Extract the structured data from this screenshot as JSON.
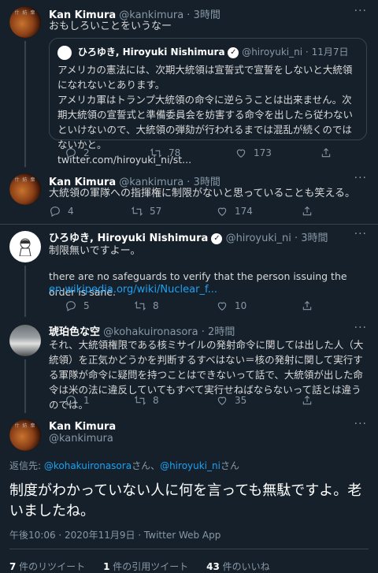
{
  "tweets": [
    {
      "name": "Kan Kimura",
      "handle": "@kankimura",
      "time": "3時間",
      "text": "おもしろいことをいうなー",
      "quote": {
        "name": "ひろゆき, Hiroyuki Nishimura",
        "handle": "@hiroyuki_ni",
        "date": "11月7日",
        "text": "アメリカの憲法には、次期大統領は宣誓式で宣誓をしないと大統領になれないとあります。\nアメリカ軍はトランプ大統領の命令に逆らうことは出来ません。次期大統領の宣誓式と準備委員会を妨害する命令を出したら従わないといけないので、大統領の弾劾が行われるまでは混乱が続くのではないかと。",
        "link": "twitter.com/hiroyuki_ni/st..."
      },
      "replies": "2",
      "retweets": "78",
      "likes": "173"
    },
    {
      "name": "Kan Kimura",
      "handle": "@kankimura",
      "time": "3時間",
      "text": "大統領の軍隊への指揮権に制限がないと思っていることも笑える。",
      "replies": "4",
      "retweets": "57",
      "likes": "174"
    },
    {
      "name": "ひろゆき, Hiroyuki Nishimura",
      "handle": "@hiroyuki_ni",
      "time": "3時間",
      "text1": "制限無いですよー。",
      "text2": "there are no safeguards to verify that the person issuing the order is sane.",
      "link": "en.wikipedia.org/wiki/Nuclear_f...",
      "replies": "5",
      "retweets": "8",
      "likes": "10"
    },
    {
      "name": "琥珀色な空",
      "handle": "@kohakuironasora",
      "time": "2時間",
      "text": "それ、大統領権限である核ミサイルの発射命令に関しては出した人（大統領）を正気かどうかを判断するすべはない＝核の発射に関して実行する軍隊が命令に疑問を持つことはできないって話で、大統領が出した命令は米の法に違反していてもすべて実行せねばならないって話とは違うのでは。",
      "replies": "1",
      "retweets": "8",
      "likes": "35"
    }
  ],
  "main": {
    "name": "Kan Kimura",
    "handle": "@kankimura",
    "reply_prefix": "返信先: ",
    "reply_user1": "@kohakuironasora",
    "reply_mid": "さん、",
    "reply_user2": "@hiroyuki_ni",
    "reply_suffix": "さん",
    "text": "制度がわかっていない人に何を言っても無駄ですよ。老いましたね。",
    "timestamp": "午後10:06 · 2020年11月9日 · Twitter Web App",
    "retweets_count": "7",
    "retweets_label": " 件のリツイート",
    "quotes_count": "1",
    "quotes_label": " 件の引用ツイート",
    "likes_count": "43",
    "likes_label": " 件のいいね"
  },
  "avatar_text": "什 紡 衆",
  "more_glyph": "···",
  "verified_glyph": "✓",
  "colors": {
    "background": "#15202b",
    "accent": "#1da1f2",
    "muted": "#8899a6"
  }
}
